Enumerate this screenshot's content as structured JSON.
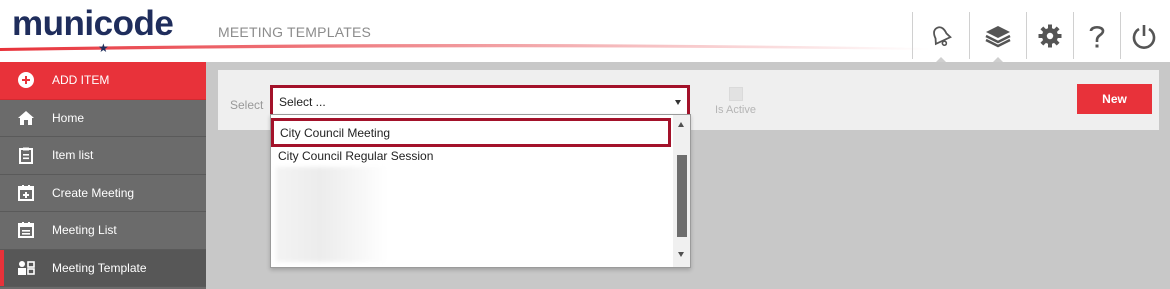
{
  "header": {
    "logo_text": "municode",
    "page_title": "MEETING TEMPLATES",
    "icons": [
      "bell-icon",
      "layers-icon",
      "gear-icon",
      "help-icon",
      "power-icon"
    ]
  },
  "sidebar": {
    "items": [
      {
        "label": "ADD ITEM",
        "icon": "plus-circle-icon"
      },
      {
        "label": "Home",
        "icon": "home-icon"
      },
      {
        "label": "Item list",
        "icon": "clipboard-icon"
      },
      {
        "label": "Create Meeting",
        "icon": "calendar-plus-icon"
      },
      {
        "label": "Meeting List",
        "icon": "calendar-list-icon"
      },
      {
        "label": "Meeting Template",
        "icon": "template-icon"
      }
    ],
    "active_index": 5
  },
  "toolbar": {
    "select_label": "Select",
    "select_value": "Select ...",
    "is_active_label": "Is Active",
    "new_button_label": "New"
  },
  "dropdown": {
    "options": [
      "City Council Meeting",
      "City Council Regular Session"
    ],
    "highlighted_index": 0
  },
  "colors": {
    "accent": "#e8323a",
    "highlight_border": "#a3122a",
    "brand": "#1f2d5c",
    "sidebar": "#6b6b6b",
    "main_bg": "#c8c8c8"
  }
}
